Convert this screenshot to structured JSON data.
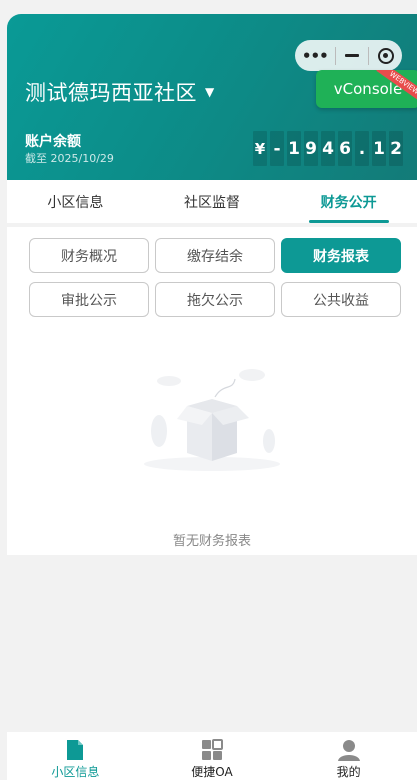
{
  "header": {
    "community_name": "测试德玛西亚社区",
    "balance_label": "账户余额",
    "as_of": "截至 2025/10/29",
    "balance_digits": [
      "¥",
      "-",
      "1",
      "9",
      "4",
      "6",
      ".",
      "1",
      "2"
    ]
  },
  "capsule": {
    "more_icon": "•••",
    "minimize_icon": "minimize-icon",
    "close_icon": "target-icon"
  },
  "vconsole": {
    "label": "vConsole",
    "ribbon": "WEBVIEW"
  },
  "tabs": [
    {
      "label": "小区信息",
      "active": false
    },
    {
      "label": "社区监督",
      "active": false
    },
    {
      "label": "财务公开",
      "active": true
    }
  ],
  "finance_buttons": [
    {
      "label": "财务概况",
      "active": false
    },
    {
      "label": "缴存结余",
      "active": false
    },
    {
      "label": "财务报表",
      "active": true
    },
    {
      "label": "审批公示",
      "active": false
    },
    {
      "label": "拖欠公示",
      "active": false
    },
    {
      "label": "公共收益",
      "active": false
    }
  ],
  "empty_state": {
    "text": "暂无财务报表"
  },
  "bottom_nav": [
    {
      "label": "小区信息",
      "icon": "document-icon",
      "active": true
    },
    {
      "label": "便捷OA",
      "icon": "grid-icon",
      "active": false
    },
    {
      "label": "我的",
      "icon": "user-icon",
      "active": false
    }
  ],
  "colors": {
    "primary": "#0d9995",
    "vconsole": "#1fb157"
  }
}
